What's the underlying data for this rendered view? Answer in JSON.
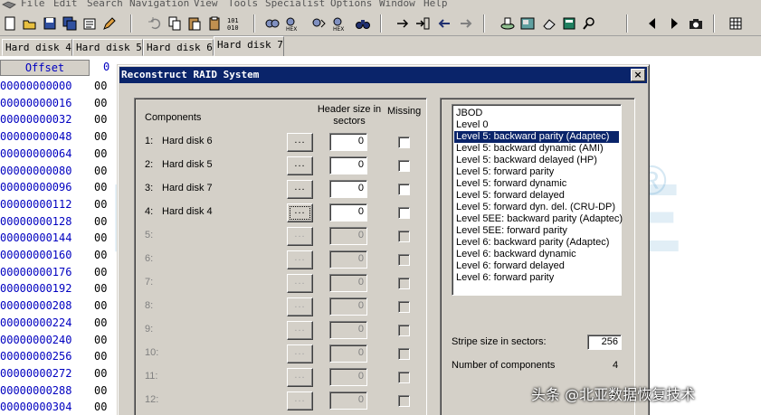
{
  "menu": {
    "items": [
      "File",
      "Edit",
      "Search",
      "Navigation",
      "View",
      "Tools",
      "Specialist",
      "Options",
      "Window",
      "Help"
    ]
  },
  "toolbar": {
    "icons": [
      "new-icon",
      "open-icon",
      "save-icon",
      "save-all-icon",
      "properties-icon",
      "edit-icon",
      "undo-icon",
      "copy-icon",
      "paste-icon",
      "clipboard-icon",
      "binary-icon",
      "find-icon",
      "find-hex-icon",
      "replace-icon",
      "replace-hex-icon",
      "binoculars-icon",
      "goto-icon",
      "goto-offset-icon",
      "back-icon",
      "forward-icon",
      "disk-icon",
      "image-icon",
      "eraser-icon",
      "calculator-icon",
      "zoom-icon",
      "prev-icon",
      "play-icon",
      "camera-icon",
      "grid-icon"
    ]
  },
  "tabs": [
    {
      "label": "Hard disk 4",
      "active": false
    },
    {
      "label": "Hard disk 5",
      "active": false
    },
    {
      "label": "Hard disk 6",
      "active": false
    },
    {
      "label": "Hard disk 7",
      "active": true
    }
  ],
  "hex": {
    "offset_header": "Offset",
    "col_header": "0",
    "rows": [
      {
        "offset": "00000000000",
        "value": "00"
      },
      {
        "offset": "00000000016",
        "value": "00"
      },
      {
        "offset": "00000000032",
        "value": "00"
      },
      {
        "offset": "00000000048",
        "value": "00"
      },
      {
        "offset": "00000000064",
        "value": "00"
      },
      {
        "offset": "00000000080",
        "value": "00"
      },
      {
        "offset": "00000000096",
        "value": "00"
      },
      {
        "offset": "00000000112",
        "value": "00"
      },
      {
        "offset": "00000000128",
        "value": "00"
      },
      {
        "offset": "00000000144",
        "value": "00"
      },
      {
        "offset": "00000000160",
        "value": "00"
      },
      {
        "offset": "00000000176",
        "value": "00"
      },
      {
        "offset": "00000000192",
        "value": "00"
      },
      {
        "offset": "00000000208",
        "value": "00"
      },
      {
        "offset": "00000000224",
        "value": "00"
      },
      {
        "offset": "00000000240",
        "value": "00"
      },
      {
        "offset": "00000000256",
        "value": "00"
      },
      {
        "offset": "00000000272",
        "value": "00"
      },
      {
        "offset": "00000000288",
        "value": "00"
      },
      {
        "offset": "00000000304",
        "value": "00"
      }
    ]
  },
  "watermark": {
    "text": "FROMBYTE",
    "mark": "®"
  },
  "dialog": {
    "title": "Reconstruct RAID System",
    "close": "×",
    "components_label": "Components",
    "header_size_label": "Header size in sectors",
    "missing_label": "Missing",
    "components": [
      {
        "num": "1:",
        "name": "Hard disk 6",
        "btn": "...",
        "value": "0",
        "enabled": true
      },
      {
        "num": "2:",
        "name": "Hard disk 5",
        "btn": "...",
        "value": "0",
        "enabled": true
      },
      {
        "num": "3:",
        "name": "Hard disk 7",
        "btn": "...",
        "value": "0",
        "enabled": true
      },
      {
        "num": "4:",
        "name": "Hard disk 4",
        "btn": "...",
        "value": "0",
        "enabled": true
      },
      {
        "num": "5:",
        "name": "",
        "btn": "...",
        "value": "0",
        "enabled": false
      },
      {
        "num": "6:",
        "name": "",
        "btn": "...",
        "value": "0",
        "enabled": false
      },
      {
        "num": "7:",
        "name": "",
        "btn": "...",
        "value": "0",
        "enabled": false
      },
      {
        "num": "8:",
        "name": "",
        "btn": "...",
        "value": "0",
        "enabled": false
      },
      {
        "num": "9:",
        "name": "",
        "btn": "...",
        "value": "0",
        "enabled": false
      },
      {
        "num": "10:",
        "name": "",
        "btn": "...",
        "value": "0",
        "enabled": false
      },
      {
        "num": "11:",
        "name": "",
        "btn": "...",
        "value": "0",
        "enabled": false
      },
      {
        "num": "12:",
        "name": "",
        "btn": "...",
        "value": "0",
        "enabled": false
      }
    ],
    "raid_types": [
      "JBOD",
      "Level 0",
      "Level 5: backward parity (Adaptec)",
      "Level 5: backward dynamic (AMI)",
      "Level 5: backward delayed (HP)",
      "Level 5: forward parity",
      "Level 5: forward dynamic",
      "Level 5: forward delayed",
      "Level 5: forward dyn. del. (CRU-DP)",
      "Level 5EE: backward parity (Adaptec)",
      "Level 5EE: forward parity",
      "Level 6: backward parity (Adaptec)",
      "Level 6: backward dynamic",
      "Level 6: forward delayed",
      "Level 6: forward parity"
    ],
    "selected_raid_type": "Level 5: backward parity (Adaptec)",
    "stripe_label": "Stripe size in sectors:",
    "stripe_value": "256",
    "num_components_label": "Number of components",
    "num_components_value": "4"
  },
  "caption": "头条 @北亚数据恢复技术"
}
